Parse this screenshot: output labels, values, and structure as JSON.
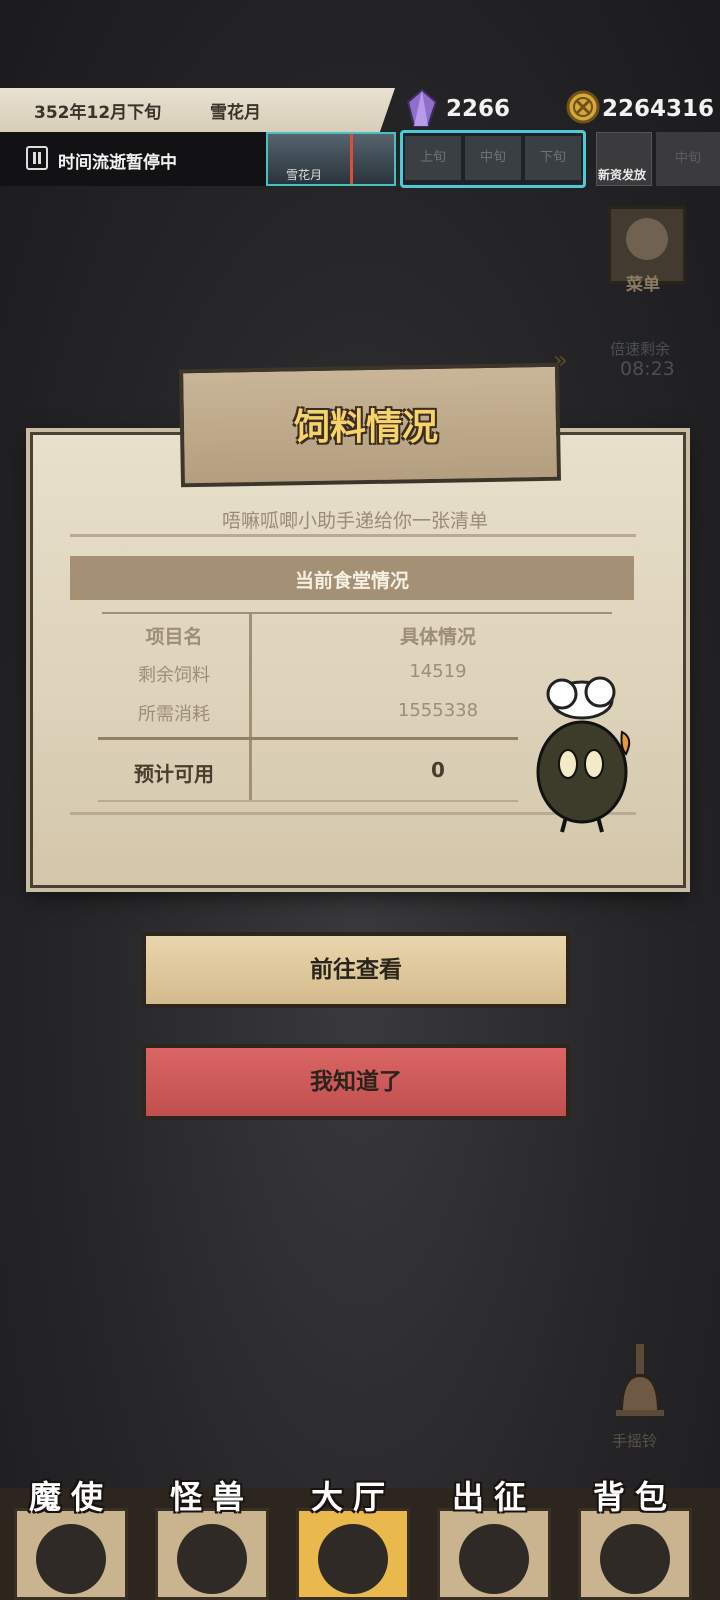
{
  "header": {
    "date": "352年12月下旬",
    "month_name": "雪花月",
    "crystals": "2266",
    "coins": "2264316",
    "time_status": "时间流逝暂停中",
    "month_card_label": "雪花月",
    "phases": [
      "上旬",
      "中旬",
      "下旬"
    ],
    "next_event": "新资发放",
    "next_phase": "中旬"
  },
  "side": {
    "menu_label": "菜单",
    "speed_label": "倍速剩余",
    "speed_time": "08:23",
    "bell_label": "手摇铃"
  },
  "dialog": {
    "title": "饲料情况",
    "subtitle": "唔嘛呱唧小助手递给你一张清单",
    "section": "当前食堂情况",
    "table": {
      "headers": [
        "项目名",
        "具体情况"
      ],
      "rows": [
        [
          "剩余饲料",
          "14519"
        ],
        [
          "所需消耗",
          "1555338"
        ]
      ],
      "total": [
        "预计可用",
        "0"
      ]
    },
    "btn_go": "前往查看",
    "btn_ok": "我知道了"
  },
  "nav": {
    "items": [
      "魔使",
      "怪兽",
      "大厅",
      "出征",
      "背包"
    ],
    "active": "大厅"
  },
  "colors": {
    "accent_gold": "#f7d36b",
    "button_go": "#e2cba0",
    "button_ok": "#d05a5a",
    "phase_border": "#4fc9d3"
  }
}
